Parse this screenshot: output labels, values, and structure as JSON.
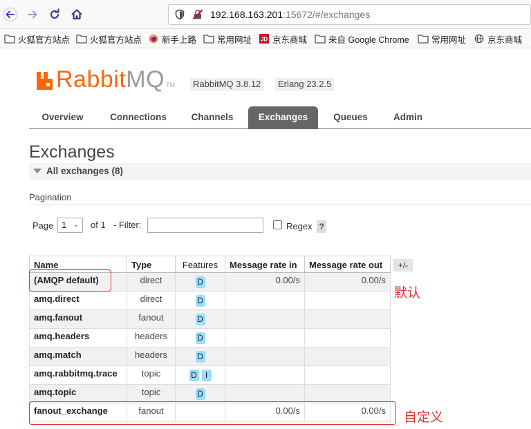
{
  "browser": {
    "url_host": "192.168.163.201",
    "url_rest": ":15672/#/exchanges",
    "bookmarks": [
      "火狐官方站点",
      "火狐官方站点",
      "新手上路",
      "常用网址",
      "京东商城",
      "来自 Google Chrome",
      "常用网址",
      "京东商城"
    ]
  },
  "header": {
    "logo_rabbit": "Rabbit",
    "logo_mq": "MQ",
    "logo_tm": "TM",
    "version": "RabbitMQ 3.8.12",
    "erlang": "Erlang 23.2.5"
  },
  "tabs": [
    "Overview",
    "Connections",
    "Channels",
    "Exchanges",
    "Queues",
    "Admin"
  ],
  "active_tab": "Exchanges",
  "page": {
    "title": "Exchanges",
    "section": "All exchanges (8)",
    "pagination_label": "Pagination",
    "page_label": "Page",
    "page_value": "1",
    "of_label": "of 1",
    "filter_label": "- Filter:",
    "regex_label": "Regex",
    "help": "?"
  },
  "table": {
    "headers": [
      "Name",
      "Type",
      "Features",
      "Message rate in",
      "Message rate out"
    ],
    "toggle": "+/-",
    "rows": [
      {
        "name": "(AMQP default)",
        "type": "direct",
        "features": [
          "D"
        ],
        "rate_in": "0.00/s",
        "rate_out": "0.00/s"
      },
      {
        "name": "amq.direct",
        "type": "direct",
        "features": [
          "D"
        ],
        "rate_in": "",
        "rate_out": ""
      },
      {
        "name": "amq.fanout",
        "type": "fanout",
        "features": [
          "D"
        ],
        "rate_in": "",
        "rate_out": ""
      },
      {
        "name": "amq.headers",
        "type": "headers",
        "features": [
          "D"
        ],
        "rate_in": "",
        "rate_out": ""
      },
      {
        "name": "amq.match",
        "type": "headers",
        "features": [
          "D"
        ],
        "rate_in": "",
        "rate_out": ""
      },
      {
        "name": "amq.rabbitmq.trace",
        "type": "topic",
        "features": [
          "D",
          "I"
        ],
        "rate_in": "",
        "rate_out": ""
      },
      {
        "name": "amq.topic",
        "type": "topic",
        "features": [
          "D"
        ],
        "rate_in": "",
        "rate_out": ""
      },
      {
        "name": "fanout_exchange",
        "type": "fanout",
        "features": [],
        "rate_in": "0.00/s",
        "rate_out": "0.00/s"
      }
    ]
  },
  "annotations": {
    "default": "默认",
    "custom": "自定义"
  },
  "colors": {
    "brand_orange": "#ff6600",
    "tab_active_bg": "#666666",
    "feature_badge": "#99ddff",
    "annotation_red": "#e03030"
  }
}
